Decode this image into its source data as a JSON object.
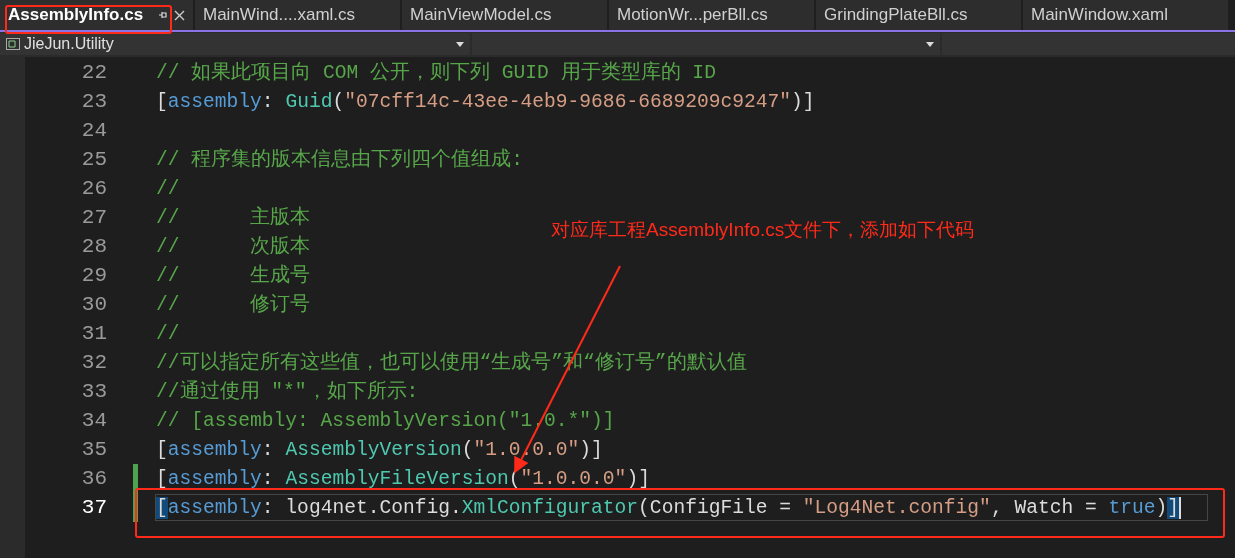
{
  "tabs": [
    {
      "label": "AssemblyInfo.cs",
      "selected": true,
      "pinned": true
    },
    {
      "label": "MainWind....xaml.cs",
      "selected": false,
      "pinned": false
    },
    {
      "label": "MainViewModel.cs",
      "selected": false,
      "pinned": false
    },
    {
      "label": "MotionWr...perBll.cs",
      "selected": false,
      "pinned": false
    },
    {
      "label": "GrindingPlateBll.cs",
      "selected": false,
      "pinned": false
    },
    {
      "label": "MainWindow.xaml",
      "selected": false,
      "pinned": false
    }
  ],
  "navigation_bar": {
    "project": "JieJun.Utility"
  },
  "editor": {
    "lines": [
      {
        "number": "22",
        "current": false,
        "changed": false,
        "tokens": [
          {
            "kind": "comment",
            "text": "// 如果此项目向 COM 公开，则下列 GUID 用于类型库的 ID"
          }
        ]
      },
      {
        "number": "23",
        "current": false,
        "changed": false,
        "tokens": [
          {
            "kind": "plain",
            "text": "["
          },
          {
            "kind": "keyword",
            "text": "assembly"
          },
          {
            "kind": "plain",
            "text": ": "
          },
          {
            "kind": "type",
            "text": "Guid"
          },
          {
            "kind": "plain",
            "text": "("
          },
          {
            "kind": "string",
            "text": "\"07cff14c-43ee-4eb9-9686-6689209c9247\""
          },
          {
            "kind": "plain",
            "text": ")]"
          }
        ]
      },
      {
        "number": "24",
        "current": false,
        "changed": false
      },
      {
        "number": "25",
        "current": false,
        "changed": false,
        "tokens": [
          {
            "kind": "comment",
            "text": "// 程序集的版本信息由下列四个值组成:"
          }
        ]
      },
      {
        "number": "26",
        "current": false,
        "changed": false,
        "tokens": [
          {
            "kind": "comment",
            "text": "//"
          }
        ]
      },
      {
        "number": "27",
        "current": false,
        "changed": false,
        "tokens": [
          {
            "kind": "comment",
            "text": "//      主版本"
          }
        ]
      },
      {
        "number": "28",
        "current": false,
        "changed": false,
        "tokens": [
          {
            "kind": "comment",
            "text": "//      次版本"
          }
        ]
      },
      {
        "number": "29",
        "current": false,
        "changed": false,
        "tokens": [
          {
            "kind": "comment",
            "text": "//      生成号"
          }
        ]
      },
      {
        "number": "30",
        "current": false,
        "changed": false,
        "tokens": [
          {
            "kind": "comment",
            "text": "//      修订号"
          }
        ]
      },
      {
        "number": "31",
        "current": false,
        "changed": false,
        "tokens": [
          {
            "kind": "comment",
            "text": "//"
          }
        ]
      },
      {
        "number": "32",
        "current": false,
        "changed": false,
        "tokens": [
          {
            "kind": "comment",
            "text": "//可以指定所有这些值，也可以使用“生成号”和“修订号”的默认值"
          }
        ]
      },
      {
        "number": "33",
        "current": false,
        "changed": false,
        "tokens": [
          {
            "kind": "comment",
            "text": "//通过使用 \"*\"，如下所示:"
          }
        ]
      },
      {
        "number": "34",
        "current": false,
        "changed": false,
        "tokens": [
          {
            "kind": "comment",
            "text": "// [assembly: AssemblyVersion(\"1.0.*\")]"
          }
        ]
      },
      {
        "number": "35",
        "current": false,
        "changed": false,
        "tokens": [
          {
            "kind": "plain",
            "text": "["
          },
          {
            "kind": "keyword",
            "text": "assembly"
          },
          {
            "kind": "plain",
            "text": ": "
          },
          {
            "kind": "type",
            "text": "AssemblyVersion"
          },
          {
            "kind": "plain",
            "text": "("
          },
          {
            "kind": "string",
            "text": "\"1.0.0.0\""
          },
          {
            "kind": "plain",
            "text": ")]"
          }
        ]
      },
      {
        "number": "36",
        "current": false,
        "changed": true,
        "tokens": [
          {
            "kind": "plain",
            "text": "["
          },
          {
            "kind": "keyword",
            "text": "assembly"
          },
          {
            "kind": "plain",
            "text": ": "
          },
          {
            "kind": "type",
            "text": "AssemblyFileVersion"
          },
          {
            "kind": "plain",
            "text": "("
          },
          {
            "kind": "string",
            "text": "\"1.0.0.0\""
          },
          {
            "kind": "plain",
            "text": ")]"
          }
        ]
      },
      {
        "number": "37",
        "current": true,
        "changed": true,
        "tokens": [
          {
            "kind": "match",
            "text": "["
          },
          {
            "kind": "keyword",
            "text": "assembly"
          },
          {
            "kind": "plain",
            "text": ": log4net.Config."
          },
          {
            "kind": "type",
            "text": "XmlConfigurator"
          },
          {
            "kind": "plain",
            "text": "(ConfigFile = "
          },
          {
            "kind": "string",
            "text": "\"Log4Net.config\""
          },
          {
            "kind": "plain",
            "text": ", Watch = "
          },
          {
            "kind": "keyword",
            "text": "true"
          },
          {
            "kind": "plain",
            "text": ")"
          },
          {
            "kind": "match",
            "text": "]"
          }
        ]
      }
    ]
  },
  "annotation": {
    "note": "对应库工程AssemblyInfo.cs文件下，添加如下代码"
  }
}
